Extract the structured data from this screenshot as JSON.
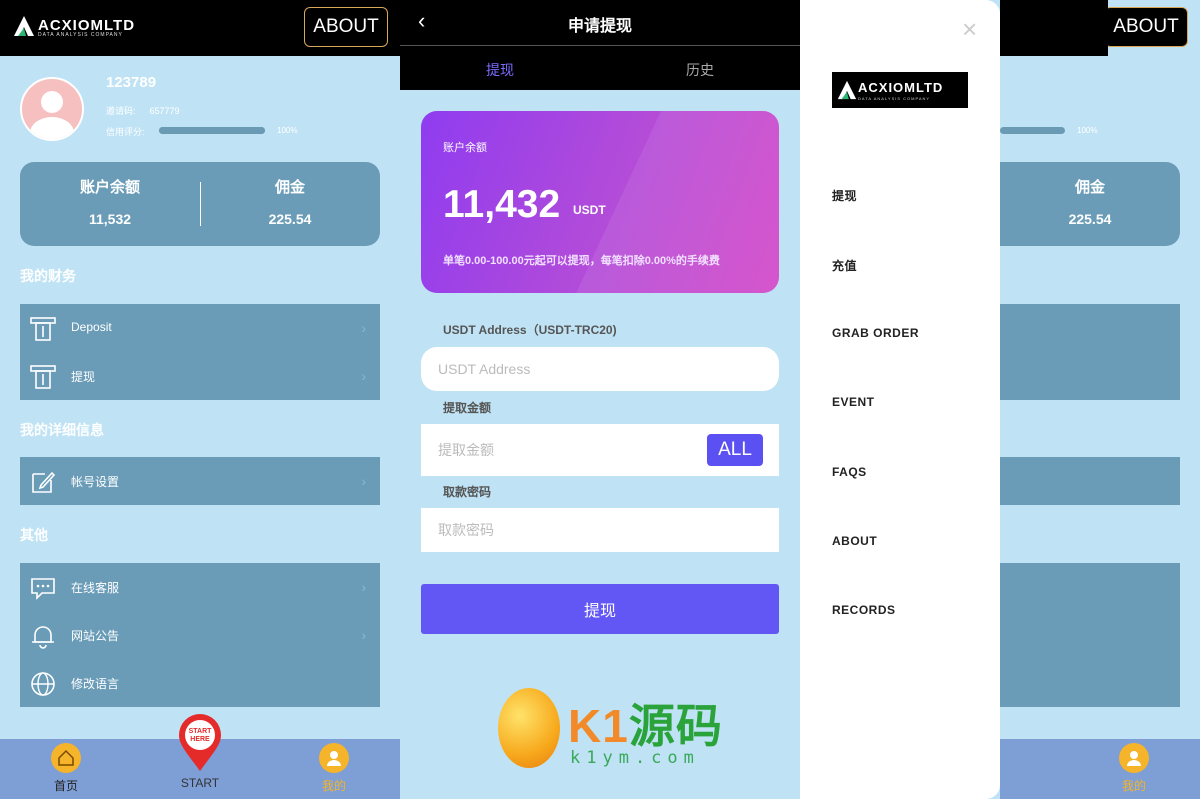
{
  "header": {
    "brand": "ACXIOMLTD",
    "brand_sub": "DATA ANALYSIS COMPANY",
    "about_label": "ABOUT"
  },
  "profile": {
    "username": "123789",
    "invite_label": "邀请码:",
    "invite_code": "657779",
    "credit_label": "信用评分:",
    "credit_value": "100%",
    "credit_fraction": 1.0
  },
  "balance": {
    "account_label": "账户余额",
    "account_value": "11,532",
    "commission_label": "佣金",
    "commission_value": "225.54"
  },
  "sections": {
    "finance": "我的财务",
    "details": "我的详细信息",
    "other": "其他"
  },
  "finance_items": [
    {
      "label": "Deposit",
      "icon": "atm-icon"
    },
    {
      "label": "提现",
      "icon": "atm-icon"
    }
  ],
  "detail_items": [
    {
      "label": "帐号设置",
      "icon": "edit-icon"
    }
  ],
  "other_items": [
    {
      "label": "在线客服",
      "icon": "chat-icon"
    },
    {
      "label": "网站公告",
      "icon": "bell-icon"
    },
    {
      "label": "修改语言",
      "icon": "globe-icon"
    }
  ],
  "nav": {
    "home": "首页",
    "start": "START",
    "start_badge": "START HERE",
    "mine": "我的"
  },
  "withdraw": {
    "back": "‹",
    "title": "申请提现",
    "tab_withdraw": "提现",
    "tab_history": "历史",
    "card_label": "账户余额",
    "card_amount": "11,432",
    "card_unit": "USDT",
    "card_note": "单笔0.00-100.00元起可以提现，每笔扣除0.00%的手续费",
    "address_label": "USDT Address（USDT-TRC20)",
    "address_placeholder": "USDT Address",
    "amount_label": "提取金额",
    "amount_placeholder": "提取金额",
    "all_label": "ALL",
    "password_label": "取款密码",
    "password_placeholder": "取款密码",
    "submit_label": "提现"
  },
  "watermark": {
    "brand_a": "K1",
    "brand_b": "源码",
    "url": "k1ym.com"
  },
  "drawer": {
    "close": "×",
    "items": [
      "提现",
      "充值",
      "GRAB ORDER",
      "EVENT",
      "FAQS",
      "ABOUT",
      "RECORDS"
    ]
  },
  "colors": {
    "accent": "#6256f5",
    "panel_bg": "#bfe3f5",
    "card_bg": "#6a9cb8",
    "header_bg": "#000000",
    "nav_bg": "#7e9ed6"
  }
}
